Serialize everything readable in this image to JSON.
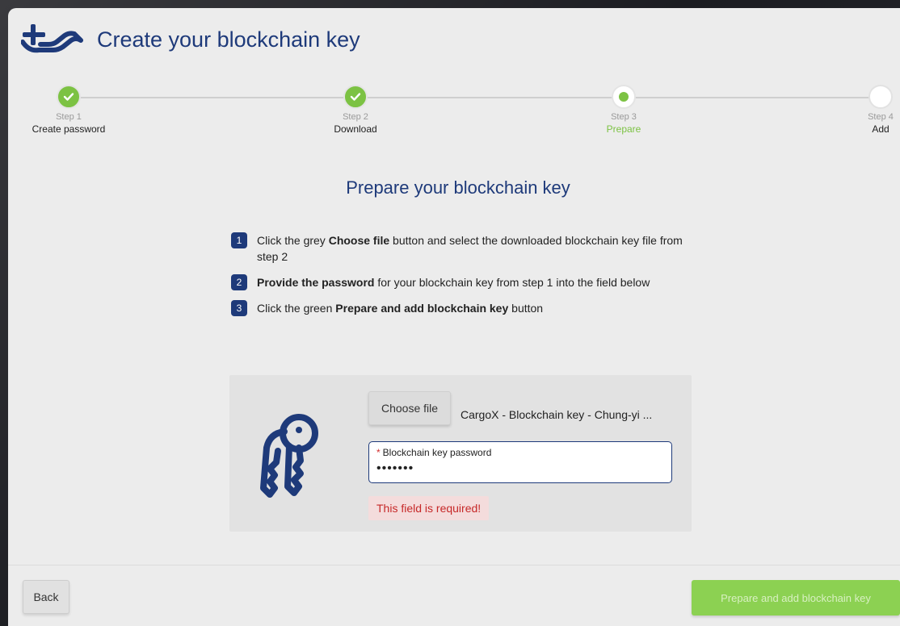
{
  "header": {
    "title": "Create your blockchain key"
  },
  "stepper": {
    "steps": [
      {
        "number": "Step 1",
        "label": "Create password",
        "status": "complete"
      },
      {
        "number": "Step 2",
        "label": "Download",
        "status": "complete"
      },
      {
        "number": "Step 3",
        "label": "Prepare",
        "status": "current"
      },
      {
        "number": "Step 4",
        "label": "Add",
        "status": "pending"
      }
    ]
  },
  "main": {
    "heading": "Prepare your blockchain key",
    "instructions": [
      {
        "index": "1",
        "pre": "Click the grey ",
        "bold": "Choose file",
        "post": " button and select the downloaded blockchain key file from step 2"
      },
      {
        "index": "2",
        "pre": "",
        "bold": "Provide the password",
        "post": " for your blockchain key from step 1 into the field below"
      },
      {
        "index": "3",
        "pre": "Click the green ",
        "bold": "Prepare and add blockchain key",
        "post": " button"
      }
    ],
    "file": {
      "choose_label": "Choose file",
      "filename": "CargoX - Blockchain key - Chung-yi ..."
    },
    "password": {
      "required_mark": "*",
      "label": "Blockchain key password",
      "value": "•••••••"
    },
    "error": "This field is required!"
  },
  "footer": {
    "back_label": "Back",
    "submit_label": "Prepare and add blockchain key"
  },
  "colors": {
    "brand": "#1e3a7a",
    "accent": "#7cc243",
    "error": "#c62828"
  }
}
